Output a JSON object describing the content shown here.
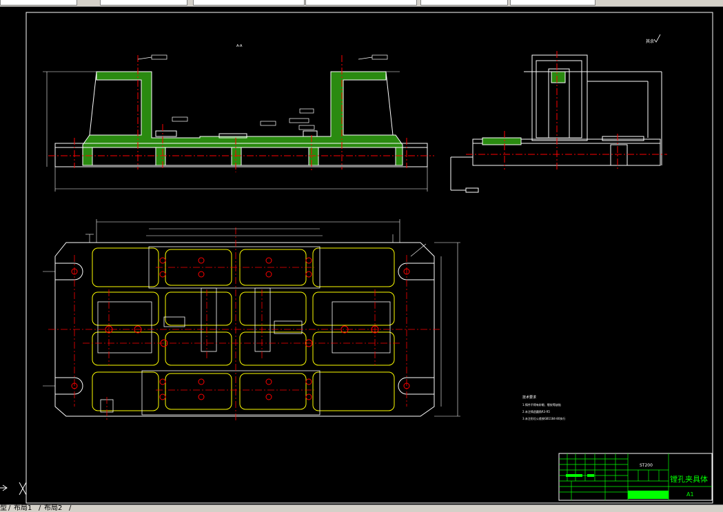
{
  "window": {
    "toolbar_fields": 6
  },
  "drawing": {
    "section_label": "A-A",
    "roughness_note": "其余",
    "title_block": {
      "drawing_no": "ST200",
      "part_name": "镗孔夹具体",
      "scale": "A1"
    },
    "tech_requirements": {
      "heading": "技术要求",
      "items": [
        "1.铸件不得有砂眼、裂纹等缺陷",
        "2.未注铸造圆角R3-R5",
        "3.未注形位公差按GB1184-80执行"
      ]
    }
  },
  "layout_tabs": {
    "model": "型",
    "tab1": "布局1",
    "tab2": "布局2"
  },
  "colors": {
    "background": "#000000",
    "outline": "#ffffff",
    "centerline": "#ff0000",
    "hatch": "#00ff00",
    "hidden": "#ffff00",
    "titleblock": "#00ff00"
  }
}
